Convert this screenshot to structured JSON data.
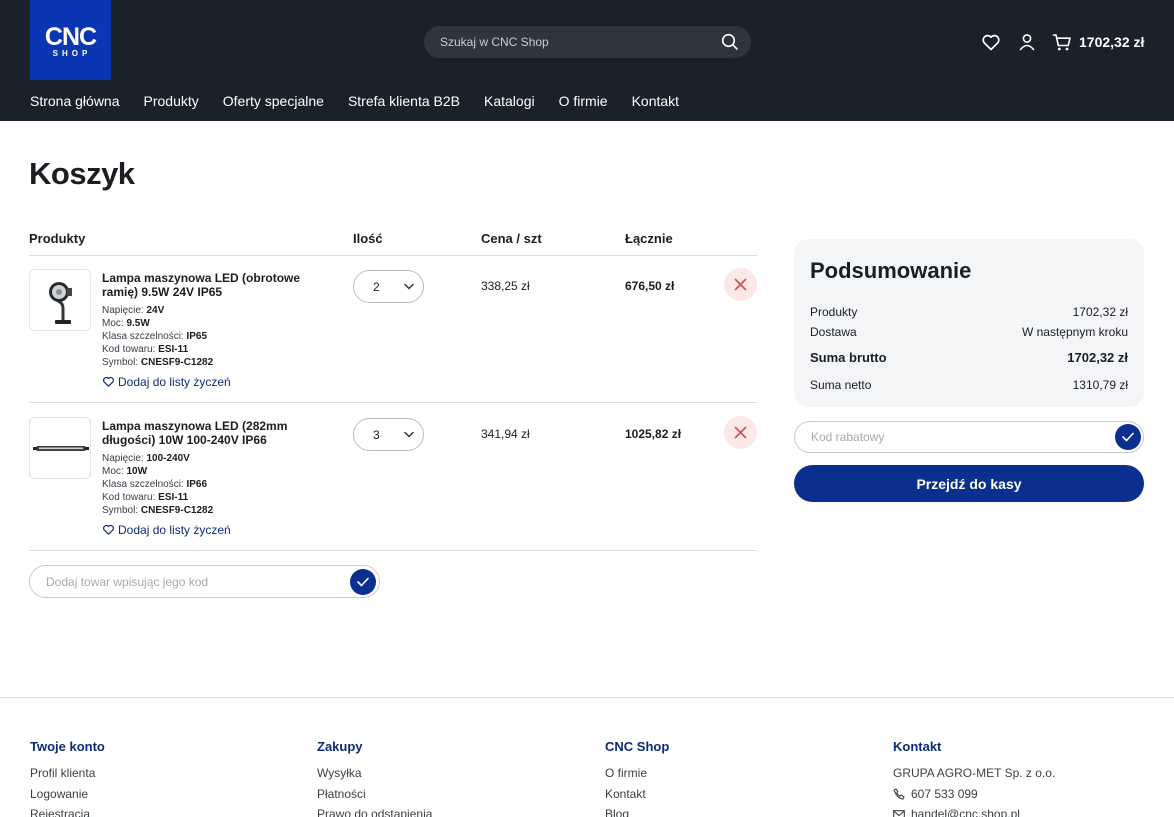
{
  "logo": {
    "line1": "CNC",
    "line2": "SHOP"
  },
  "search": {
    "placeholder": "Szukaj w CNC Shop"
  },
  "header": {
    "cart_total": "1702,32 zł"
  },
  "nav": [
    "Strona główna",
    "Produkty",
    "Oferty specjalne",
    "Strefa klienta B2B",
    "Katalogi",
    "O firmie",
    "Kontakt"
  ],
  "cart": {
    "title": "Koszyk",
    "columns": {
      "products": "Produkty",
      "qty": "Ilość",
      "price": "Cena / szt",
      "total": "Łącznie"
    },
    "items": [
      {
        "name": "Lampa maszynowa LED (obrotowe ramię) 9.5W 24V IP65",
        "attrs": [
          {
            "label": "Napięcie:",
            "value": "24V"
          },
          {
            "label": "Moc:",
            "value": "9.5W"
          },
          {
            "label": "Klasa szczelności:",
            "value": "IP65"
          },
          {
            "label": "Kod towaru:",
            "value": "ESI-11"
          },
          {
            "label": "Symbol:",
            "value": "CNESF9-C1282"
          }
        ],
        "wishlist": "Dodaj do listy życzeń",
        "qty": "2",
        "price": "338,25 zł",
        "total": "676,50 zł"
      },
      {
        "name": "Lampa maszynowa LED (282mm długości) 10W 100-240V IP66",
        "attrs": [
          {
            "label": "Napięcie:",
            "value": "100-240V"
          },
          {
            "label": "Moc:",
            "value": "10W"
          },
          {
            "label": "Klasa szczelności:",
            "value": "IP66"
          },
          {
            "label": "Kod towaru:",
            "value": "ESI-11"
          },
          {
            "label": "Symbol:",
            "value": "CNESF9-C1282"
          }
        ],
        "wishlist": "Dodaj do listy życzeń",
        "qty": "3",
        "price": "341,94 zł",
        "total": "1025,82 zł"
      }
    ],
    "add_code_placeholder": "Dodaj towar wpisując jego kod"
  },
  "summary": {
    "title": "Podsumowanie",
    "products_label": "Produkty",
    "products_value": "1702,32 zł",
    "shipping_label": "Dostawa",
    "shipping_value": "W następnym kroku",
    "gross_label": "Suma brutto",
    "gross_value": "1702,32 zł",
    "net_label": "Suma netto",
    "net_value": "1310,79 zł",
    "coupon_placeholder": "Kod rabatowy",
    "checkout_label": "Przejdź do kasy"
  },
  "footer": {
    "account": {
      "title": "Twoje konto",
      "links": [
        "Profil klienta",
        "Logowanie",
        "Rejestracja"
      ]
    },
    "shopping": {
      "title": "Zakupy",
      "links": [
        "Wysyłka",
        "Płatności",
        "Prawo do odstąpienia"
      ]
    },
    "shop": {
      "title": "CNC Shop",
      "links": [
        "O firmie",
        "Kontakt",
        "Blog"
      ]
    },
    "contact": {
      "title": "Kontakt",
      "company": "GRUPA AGRO-MET Sp. z o.o.",
      "phone": "607 533 099",
      "email": "handel@cnc.shop.pl"
    }
  },
  "colors": {
    "header_bg": "#1b212b",
    "brand_blue": "#0b36b3",
    "primary": "#0b2f8f",
    "link": "#0d2b7a",
    "remove_bg": "#fde8e8",
    "remove_icon": "#e0474c"
  }
}
